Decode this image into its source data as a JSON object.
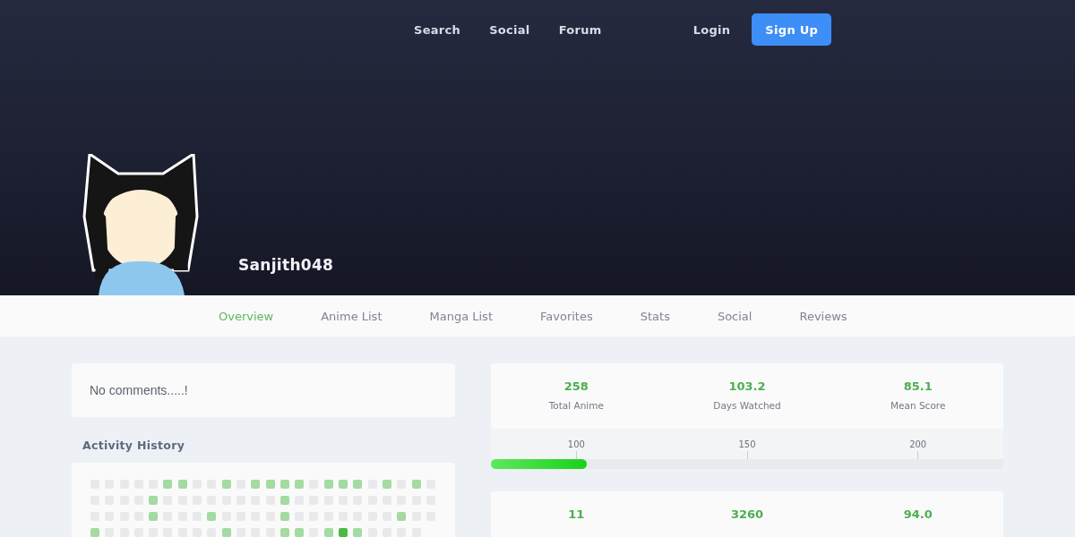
{
  "nav": {
    "links": [
      "Search",
      "Social",
      "Forum"
    ],
    "login": "Login",
    "signup": "Sign Up"
  },
  "profile": {
    "username": "Sanjith048"
  },
  "tabs": [
    {
      "label": "Overview",
      "selected": true
    },
    {
      "label": "Anime List",
      "selected": false
    },
    {
      "label": "Manga List",
      "selected": false
    },
    {
      "label": "Favorites",
      "selected": false
    },
    {
      "label": "Stats",
      "selected": false
    },
    {
      "label": "Social",
      "selected": false
    },
    {
      "label": "Reviews",
      "selected": false
    }
  ],
  "comments": {
    "text": "No comments.....!"
  },
  "activity": {
    "title": "Activity History",
    "rows": [
      {
        "cells": [
          {
            "color": "#e8e9eb"
          },
          {
            "color": "#e8e9eb"
          },
          {
            "color": "#e8e9eb"
          },
          {
            "color": "#e8e9eb"
          },
          {
            "color": "#e8e9eb"
          },
          {
            "color": "#a3dba0"
          },
          {
            "color": "#a3dba0"
          },
          {
            "color": "#e8e9eb"
          },
          {
            "color": "#e8e9eb"
          },
          {
            "color": "#a3dba0"
          },
          {
            "color": "#e8e9eb"
          },
          {
            "color": "#a3dba0"
          },
          {
            "color": "#a3dba0"
          },
          {
            "color": "#a3dba0"
          },
          {
            "color": "#a3dba0"
          },
          {
            "color": "#e8e9eb"
          },
          {
            "color": "#a3dba0"
          },
          {
            "color": "#a3dba0"
          },
          {
            "color": "#a3dba0"
          },
          {
            "color": "#e8e9eb"
          },
          {
            "color": "#a3dba0"
          },
          {
            "color": "#e8e9eb"
          },
          {
            "color": "#a3dba0"
          },
          {
            "color": "#e8e9eb"
          }
        ]
      },
      {
        "cells": [
          {
            "color": "#e8e9eb"
          },
          {
            "color": "#e8e9eb"
          },
          {
            "color": "#e8e9eb"
          },
          {
            "color": "#e8e9eb"
          },
          {
            "color": "#a3dba0"
          },
          {
            "color": "#e8e9eb"
          },
          {
            "color": "#e8e9eb"
          },
          {
            "color": "#e8e9eb"
          },
          {
            "color": "#e8e9eb"
          },
          {
            "color": "#e8e9eb"
          },
          {
            "color": "#e8e9eb"
          },
          {
            "color": "#e8e9eb"
          },
          {
            "color": "#e8e9eb"
          },
          {
            "color": "#a3dba0"
          },
          {
            "color": "#e8e9eb"
          },
          {
            "color": "#e8e9eb"
          },
          {
            "color": "#e8e9eb"
          },
          {
            "color": "#e8e9eb"
          },
          {
            "color": "#e8e9eb"
          },
          {
            "color": "#e8e9eb"
          },
          {
            "color": "#e8e9eb"
          },
          {
            "color": "#e8e9eb"
          },
          {
            "color": "#e8e9eb"
          },
          {
            "color": "#e8e9eb"
          }
        ]
      },
      {
        "cells": [
          {
            "color": "#e8e9eb"
          },
          {
            "color": "#e8e9eb"
          },
          {
            "color": "#e8e9eb"
          },
          {
            "color": "#e8e9eb"
          },
          {
            "color": "#a3dba0"
          },
          {
            "color": "#e8e9eb"
          },
          {
            "color": "#e8e9eb"
          },
          {
            "color": "#e8e9eb"
          },
          {
            "color": "#a3dba0"
          },
          {
            "color": "#e8e9eb"
          },
          {
            "color": "#e8e9eb"
          },
          {
            "color": "#e8e9eb"
          },
          {
            "color": "#e8e9eb"
          },
          {
            "color": "#a3dba0"
          },
          {
            "color": "#e8e9eb"
          },
          {
            "color": "#e8e9eb"
          },
          {
            "color": "#e8e9eb"
          },
          {
            "color": "#e8e9eb"
          },
          {
            "color": "#e8e9eb"
          },
          {
            "color": "#e8e9eb"
          },
          {
            "color": "#e8e9eb"
          },
          {
            "color": "#a3dba0"
          },
          {
            "color": "#e8e9eb"
          },
          {
            "color": "#e8e9eb"
          }
        ]
      },
      {
        "cells": [
          {
            "color": "#a3dba0"
          },
          {
            "color": "#e8e9eb"
          },
          {
            "color": "#e8e9eb"
          },
          {
            "color": "#e8e9eb"
          },
          {
            "color": "#e8e9eb"
          },
          {
            "color": "#e8e9eb"
          },
          {
            "color": "#e8e9eb"
          },
          {
            "color": "#e8e9eb"
          },
          {
            "color": "#e8e9eb"
          },
          {
            "color": "#a3dba0"
          },
          {
            "color": "#e8e9eb"
          },
          {
            "color": "#e8e9eb"
          },
          {
            "color": "#e8e9eb"
          },
          {
            "color": "#a3dba0"
          },
          {
            "color": "#a3dba0"
          },
          {
            "color": "#e8e9eb"
          },
          {
            "color": "#a3dba0"
          },
          {
            "color": "#4cb944"
          },
          {
            "color": "#a3dba0"
          },
          {
            "color": "#e8e9eb"
          },
          {
            "color": "#e8e9eb"
          },
          {
            "color": "#e8e9eb"
          },
          {
            "color": "#e8e9eb"
          }
        ]
      }
    ]
  },
  "anime_stats": {
    "stats": [
      {
        "value": "258",
        "label": "Total Anime"
      },
      {
        "value": "103.2",
        "label": "Days Watched"
      },
      {
        "value": "85.1",
        "label": "Mean Score"
      }
    ],
    "milestones": [
      "100",
      "150",
      "200"
    ],
    "level": 0.187
  },
  "manga_stats": {
    "values": [
      "11",
      "3260",
      "94.0"
    ]
  }
}
